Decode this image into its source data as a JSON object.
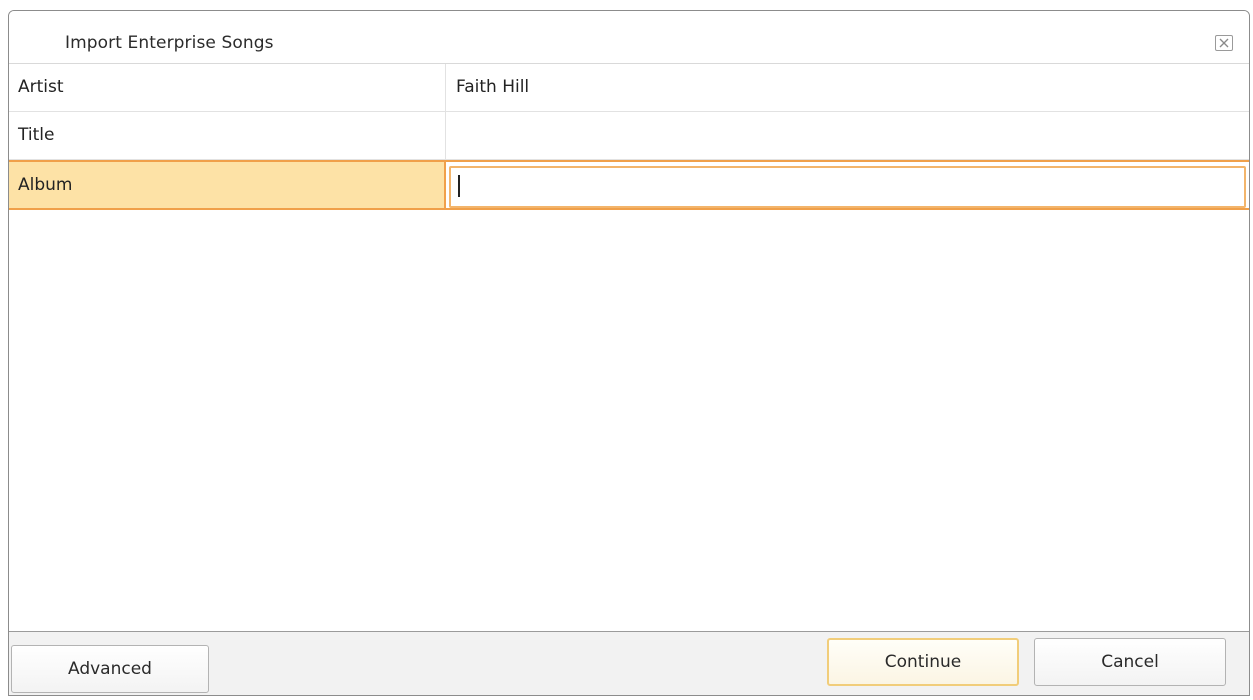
{
  "window": {
    "title": "Import Enterprise Songs",
    "close_icon": "close-icon"
  },
  "fields": [
    {
      "label": "Artist",
      "value": "Faith Hill"
    },
    {
      "label": "Title",
      "value": ""
    },
    {
      "label": "Album",
      "value": ""
    }
  ],
  "footer": {
    "advanced_label": "Advanced",
    "continue_label": "Continue",
    "cancel_label": "Cancel"
  },
  "colors": {
    "active_row": "#fde2a6",
    "active_border": "#f0a04a",
    "default_button_border": "#f1cd7a"
  }
}
